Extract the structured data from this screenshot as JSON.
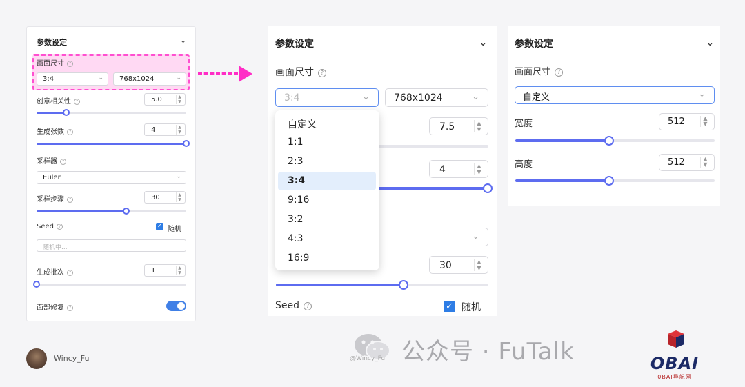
{
  "left_panel": {
    "title": "参数设定",
    "size_label": "画面尺寸",
    "ratio_value": "3:4",
    "resolution_value": "768x1024",
    "creativity_label": "创意相关性",
    "creativity_value": "5.0",
    "creativity_level": 0.2,
    "count_label": "生成张数",
    "count_value": "4",
    "count_level": 1.0,
    "sampler_label": "采样器",
    "sampler_value": "Euler",
    "steps_label": "采样步骤",
    "steps_value": "30",
    "steps_level": 0.6,
    "seed_label": "Seed",
    "random_label": "随机",
    "seed_placeholder": "随机中...",
    "batch_label": "生成批次",
    "batch_value": "1",
    "batch_level": 0.0,
    "face_fix_label": "面部修复",
    "face_fix_on": true
  },
  "middle_panel": {
    "title": "参数设定",
    "size_label": "画面尺寸",
    "ratio_value": "3:4",
    "resolution_value": "768x1024",
    "creativity_value": "7.5",
    "count_value": "4",
    "steps_value": "30",
    "steps_level": 0.6,
    "seed_label": "Seed",
    "random_label": "随机",
    "ratio_options": [
      "自定义",
      "1:1",
      "2:3",
      "3:4",
      "9:16",
      "3:2",
      "4:3",
      "16:9"
    ],
    "selected_option": "3:4"
  },
  "right_panel": {
    "title": "参数设定",
    "size_label": "画面尺寸",
    "ratio_value": "自定义",
    "width_label": "宽度",
    "width_value": "512",
    "width_level": 0.47,
    "height_label": "高度",
    "height_value": "512",
    "height_level": 0.47
  },
  "footer": {
    "author": "Wincy_Fu",
    "watermark_small": "@Wincy_Fu",
    "watermark_big": "公众号 · FuTalk",
    "logo_text": "OBAI",
    "logo_sub": "0BAI导航网"
  },
  "colors": {
    "accent": "#5d6cf0",
    "highlight": "#ff2dc6",
    "check": "#2e7de5"
  }
}
